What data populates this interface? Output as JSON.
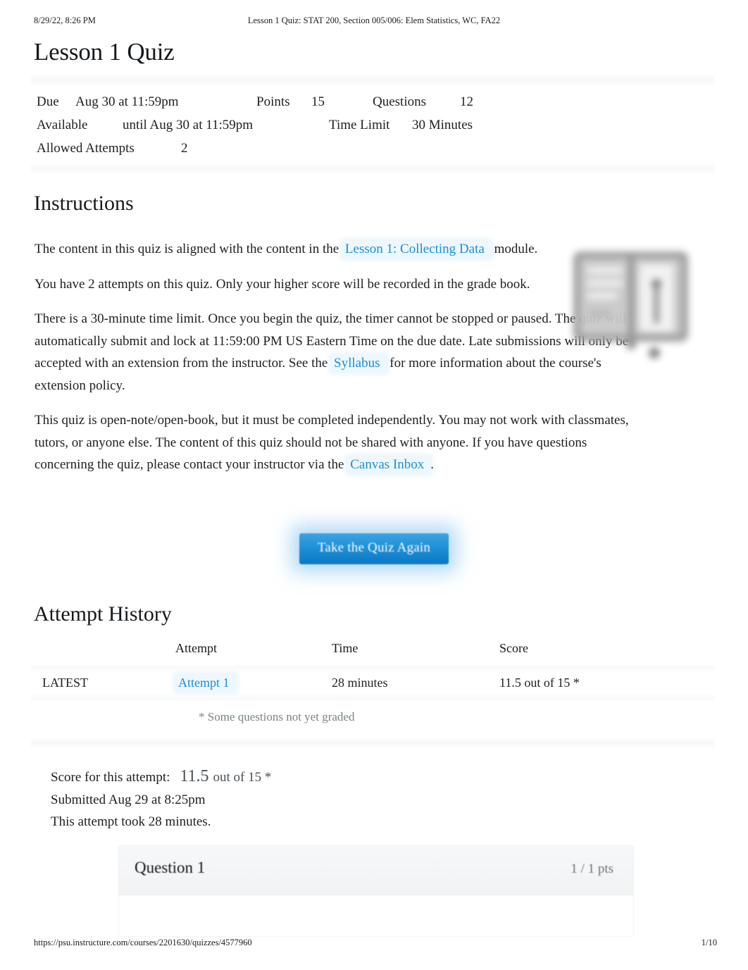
{
  "print_header": {
    "date": "8/29/22, 8:26 PM",
    "title": "Lesson 1 Quiz: STAT 200, Section 005/006: Elem Statistics, WC, FA22"
  },
  "page_title": "Lesson 1 Quiz",
  "quiz_meta": {
    "due_label": "Due",
    "due_value": "Aug 30 at 11:59pm",
    "points_label": "Points",
    "points_value": "15",
    "questions_label": "Questions",
    "questions_value": "12",
    "available_label": "Available",
    "available_value": "until Aug 30 at 11:59pm",
    "time_limit_label": "Time Limit",
    "time_limit_value": "30 Minutes",
    "attempts_label": "Allowed Attempts",
    "attempts_value": "2"
  },
  "instructions": {
    "heading": "Instructions",
    "p1_before": "The content in this quiz is aligned with the content in the",
    "p1_link": "Lesson 1: Collecting Data",
    "p1_after": "module.",
    "p2": "You have 2 attempts on this quiz. Only your higher score will be recorded in the grade book.",
    "p3_before": "There is a 30-minute time limit. Once you begin the quiz, the timer cannot be stopped or paused. The quiz will automatically submit and lock at 11:59:00 PM US Eastern Time on the due date. Late submissions will only be accepted with an extension from the instructor. See the",
    "p3_link": "Syllabus",
    "p3_after": "for more information about the course's extension policy.",
    "p4_before": "This quiz is open-note/open-book, but it must be completed independently. You may not work with classmates, tutors, or anyone else. The content of this quiz should not be shared with anyone. If you have questions concerning the quiz, please contact your instructor via the",
    "p4_link": "Canvas Inbox",
    "p4_after": "."
  },
  "cta": {
    "take_quiz_again": "Take the Quiz Again"
  },
  "attempt_history": {
    "heading": "Attempt History",
    "columns": [
      "",
      "Attempt",
      "Time",
      "Score"
    ],
    "rows": [
      {
        "kept": "LATEST",
        "attempt": "Attempt 1",
        "time": "28 minutes",
        "score": "11.5 out of 15 *"
      }
    ],
    "footnote": "* Some questions not yet graded"
  },
  "score_summary": {
    "score_label": "Score for this attempt:",
    "score_value": "11.5",
    "score_suffix": "out of 15 *",
    "submitted": "Submitted Aug 29 at 8:25pm",
    "duration": "This attempt took 28 minutes."
  },
  "question": {
    "title": "Question 1",
    "points": "1 / 1 pts"
  },
  "print_footer": {
    "url": "https://psu.instructure.com/courses/2201630/quizzes/4577960",
    "page": "1/10"
  },
  "colors": {
    "link_blue": "#1a8fd8",
    "button_blue_top": "#3ba3e3",
    "button_blue_bottom": "#0a76c0",
    "text": "#1c1f22",
    "muted": "#7a8388"
  }
}
